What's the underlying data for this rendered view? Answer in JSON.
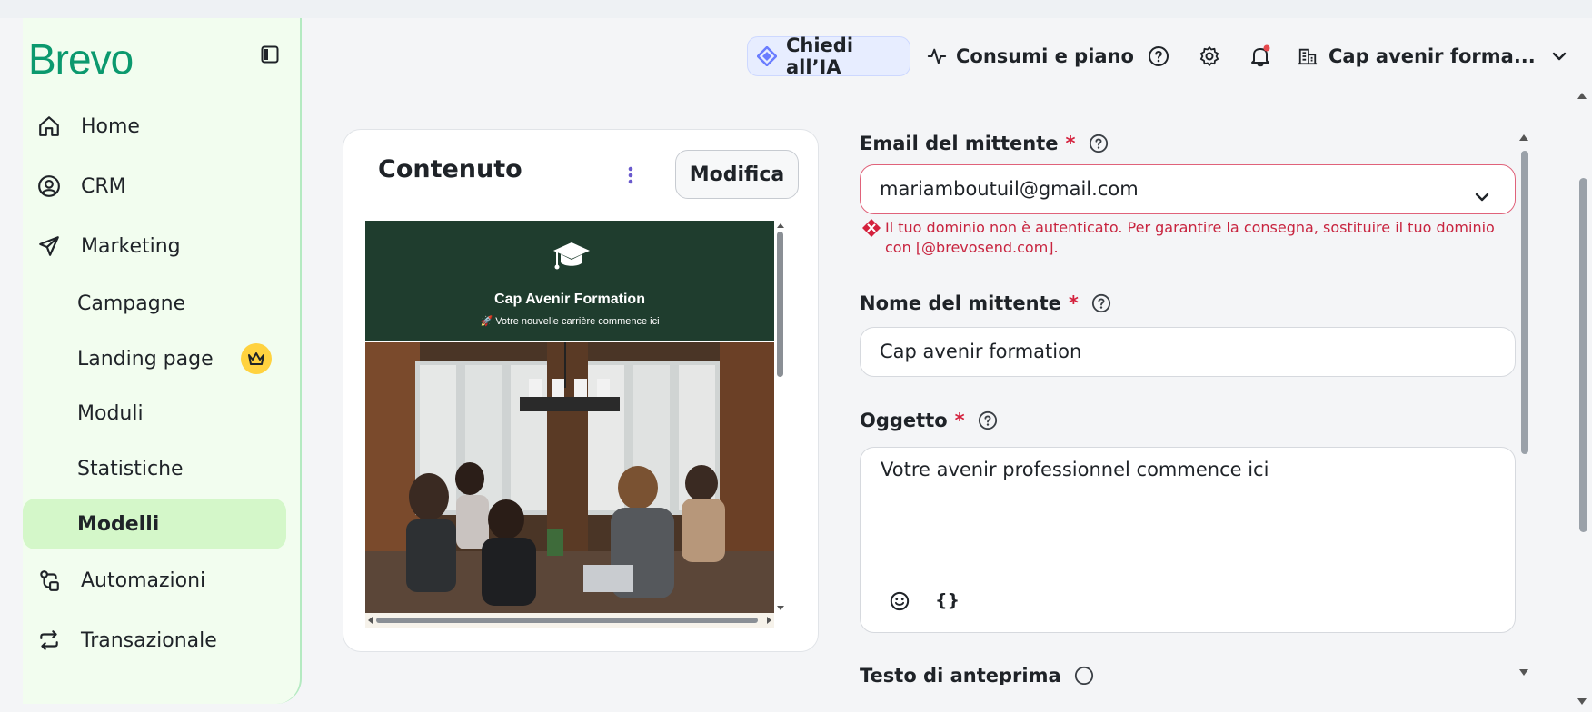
{
  "sidebar": {
    "logo": "Brevo",
    "items": [
      {
        "label": "Home",
        "icon": "home-icon"
      },
      {
        "label": "CRM",
        "icon": "user-circle-icon"
      },
      {
        "label": "Marketing",
        "icon": "send-icon"
      },
      {
        "label": "Campagne"
      },
      {
        "label": "Landing page",
        "badge_icon": "crown-icon"
      },
      {
        "label": "Moduli"
      },
      {
        "label": "Statistiche"
      },
      {
        "label": "Modelli",
        "active": true
      },
      {
        "label": "Automazioni",
        "icon": "automation-icon"
      },
      {
        "label": "Transazionale",
        "icon": "repeat-icon"
      }
    ]
  },
  "header": {
    "ai_button": "Chiedi all’IA",
    "usage_button": "Consumi e piano",
    "account_name": "Cap avenir forma..."
  },
  "content_card": {
    "title": "Contenuto",
    "edit_button": "Modifica",
    "preview": {
      "title": "Cap Avenir Formation",
      "subtitle": "🚀 Votre nouvelle carrière commence ici"
    }
  },
  "form": {
    "sender_email": {
      "label": "Email del mittente",
      "required": "*",
      "value": "mariamboutuil@gmail.com",
      "error": "Il tuo dominio non è autenticato. Per garantire la consegna, sostituire il tuo dominio con [@brevosend.com]."
    },
    "sender_name": {
      "label": "Nome del mittente",
      "required": "*",
      "value": "Cap avenir formation"
    },
    "subject": {
      "label": "Oggetto",
      "required": "*",
      "value": "Votre avenir professionnel commence ici",
      "emoji_icon": "emoji-icon",
      "personalization_label": "{}"
    },
    "preview_text": {
      "label": "Testo di anteprima"
    }
  },
  "colors": {
    "brand": "#0b996e",
    "sidebar_bg": "#f2fdef",
    "active_item": "#d4f7c9",
    "error": "#c8243f",
    "email_header": "#1f3d2e",
    "ai_accent": "#6a7dff"
  }
}
